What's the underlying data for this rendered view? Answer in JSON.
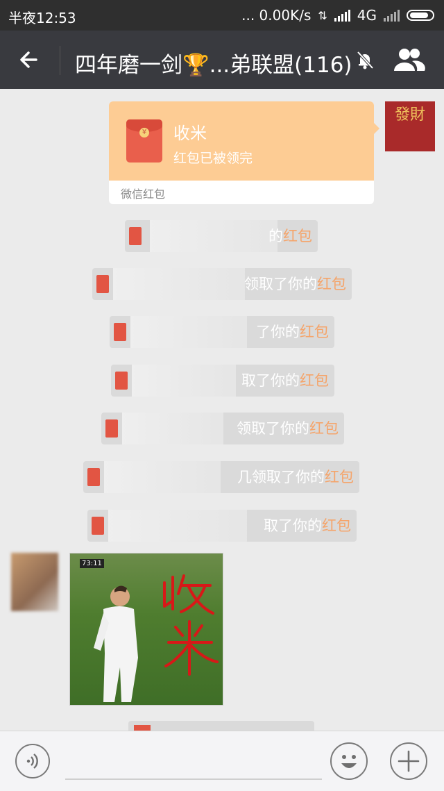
{
  "status_bar": {
    "time": "半夜12:53",
    "net_speed": "... 0.00K/s",
    "network": "4G"
  },
  "header": {
    "title": "四年磨一剑🏆...弟联盟(116)"
  },
  "red_packet": {
    "greeting": "收米",
    "status": "红包已被领完",
    "footer": "微信红包"
  },
  "sender_avatar": {
    "text": "發財"
  },
  "system_messages": [
    {
      "text": "的",
      "highlight": "红包"
    },
    {
      "text": "领取了你的",
      "highlight": "红包"
    },
    {
      "text": "了你的",
      "highlight": "红包"
    },
    {
      "text": "取了你的",
      "highlight": "红包"
    },
    {
      "text": "领取了你的",
      "highlight": "红包"
    },
    {
      "text": "几领取了你的",
      "highlight": "红包"
    },
    {
      "text": "取了你的",
      "highlight": "红包"
    }
  ],
  "image_message": {
    "timestamp": "73:11",
    "handwriting": "收米"
  },
  "colors": {
    "topbar": "#393a3f",
    "red_packet": "#fdcc94",
    "highlight": "#f5a46a"
  }
}
